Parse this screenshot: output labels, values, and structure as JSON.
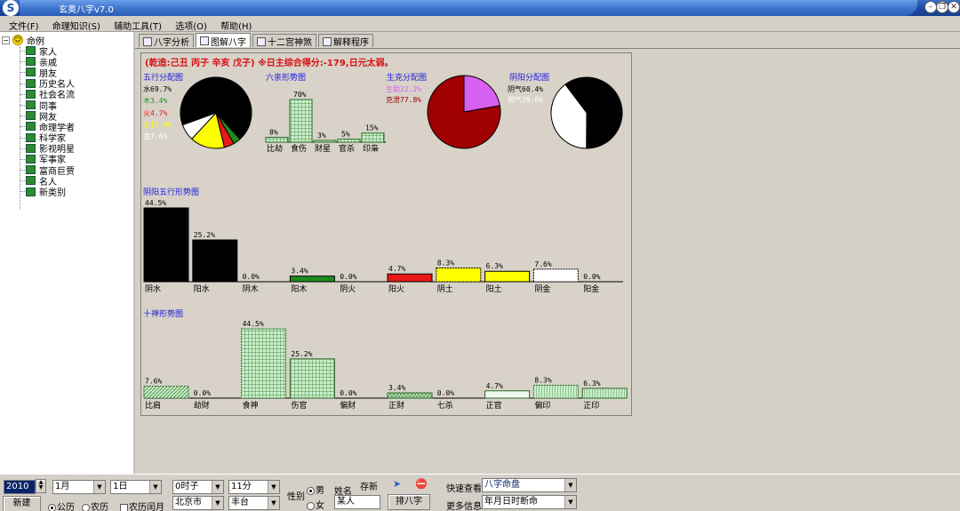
{
  "window": {
    "title": "玄奥八字v7.0"
  },
  "menu": [
    "文件(F)",
    "命理知识(S)",
    "辅助工具(T)",
    "选项(O)",
    "帮助(H)"
  ],
  "tree": {
    "root": "命例",
    "items": [
      "家人",
      "亲戚",
      "朋友",
      "历史名人",
      "社会名流",
      "同事",
      "网友",
      "命理学者",
      "科学家",
      "影视明星",
      "军事家",
      "富商巨贾",
      "名人",
      "新类别"
    ]
  },
  "tabs": [
    "八字分析",
    "图解八字",
    "十二宫神煞",
    "解释程序"
  ],
  "chart": {
    "header": "(乾造:己丑  丙子  辛亥  戊子)   ※日主综合得分:-179,日元太弱。",
    "wuxing": {
      "title": "五行分配图",
      "items": [
        {
          "label": "水69.7%",
          "value": 69.7,
          "color": "#000000"
        },
        {
          "label": "木3.4%",
          "value": 3.4,
          "color": "#1e8c1e"
        },
        {
          "label": "火4.7%",
          "value": 4.7,
          "color": "#e81818"
        },
        {
          "label": "土15.9%",
          "value": 15.9,
          "color": "#ffff00"
        },
        {
          "label": "金7.6%",
          "value": 7.6,
          "color": "#ffffff"
        }
      ]
    },
    "liuqin": {
      "title": "六亲形势图",
      "categories": [
        "比劫",
        "食伤",
        "财星",
        "官杀",
        "印枭"
      ],
      "values": [
        8,
        70,
        3,
        5,
        15
      ],
      "labels": [
        "8%",
        "70%",
        "3%",
        "5%",
        "15%"
      ]
    },
    "shengke": {
      "title": "生克分配图",
      "items": [
        {
          "label": "生助22.2%",
          "value": 22.2,
          "color": "#d860f0"
        },
        {
          "label": "克泄77.8%",
          "value": 77.8,
          "color": "#a00000"
        }
      ]
    },
    "yinyang": {
      "title": "阴阳分配图",
      "items": [
        {
          "label": "阴气60.4%",
          "value": 60.4,
          "color": "#000000"
        },
        {
          "label": "阳气39.6%",
          "value": 39.6,
          "color": "#ffffff"
        }
      ]
    },
    "yinyang_wuxing": {
      "title": "阴阳五行形势图",
      "categories": [
        "阴水",
        "阳水",
        "阴木",
        "阳木",
        "阴火",
        "阳火",
        "阴土",
        "阳土",
        "阴金",
        "阳金"
      ],
      "values": [
        44.5,
        25.2,
        0.0,
        3.4,
        0.0,
        4.7,
        8.3,
        6.3,
        7.6,
        0.0
      ],
      "labels": [
        "44.5%",
        "25.2%",
        "0.0%",
        "3.4%",
        "0.0%",
        "4.7%",
        "8.3%",
        "6.3%",
        "7.6%",
        "0.0%"
      ],
      "colors": [
        "#000000",
        "#000000",
        "#1e8c1e",
        "#1e8c1e",
        "#e81818",
        "#e81818",
        "#ffff00",
        "#ffff00",
        "#ffffff",
        "#ffffff"
      ],
      "dashed": [
        false,
        false,
        false,
        false,
        false,
        false,
        true,
        false,
        true,
        false
      ]
    },
    "shishen": {
      "title": "十神形势图",
      "categories": [
        "比肩",
        "劫财",
        "食神",
        "伤官",
        "偏财",
        "正财",
        "七杀",
        "正官",
        "偏印",
        "正印"
      ],
      "values": [
        7.6,
        0.0,
        44.5,
        25.2,
        0.0,
        3.4,
        0.0,
        4.7,
        8.3,
        6.3
      ],
      "labels": [
        "7.6%",
        "0.0%",
        "44.5%",
        "25.2%",
        "0.0%",
        "3.4%",
        "0.0%",
        "4.7%",
        "8.3%",
        "6.3%"
      ],
      "patterns": [
        "diag",
        "none",
        "grid",
        "grid",
        "none",
        "cross",
        "none",
        "plain",
        "vert-dashed",
        "vert"
      ]
    }
  },
  "bottom": {
    "year": "2010",
    "month": "1月",
    "day": "1日",
    "hour": "0时子",
    "minute": "11分",
    "gender_label": "性别",
    "male": "男",
    "female": "女",
    "name_label": "姓名",
    "name_value": "某人",
    "save_label": "存新",
    "new_button": "新建",
    "calendar_solar": "公历",
    "calendar_lunar": "农历",
    "lunar_leap": "农历闰月",
    "province": "北京市",
    "district": "丰台",
    "pai_button": "排八字",
    "quick_label": "快速查看",
    "quick_value": "八字命盘",
    "more_label": "更多信息",
    "more_value": "年月日时断命"
  }
}
